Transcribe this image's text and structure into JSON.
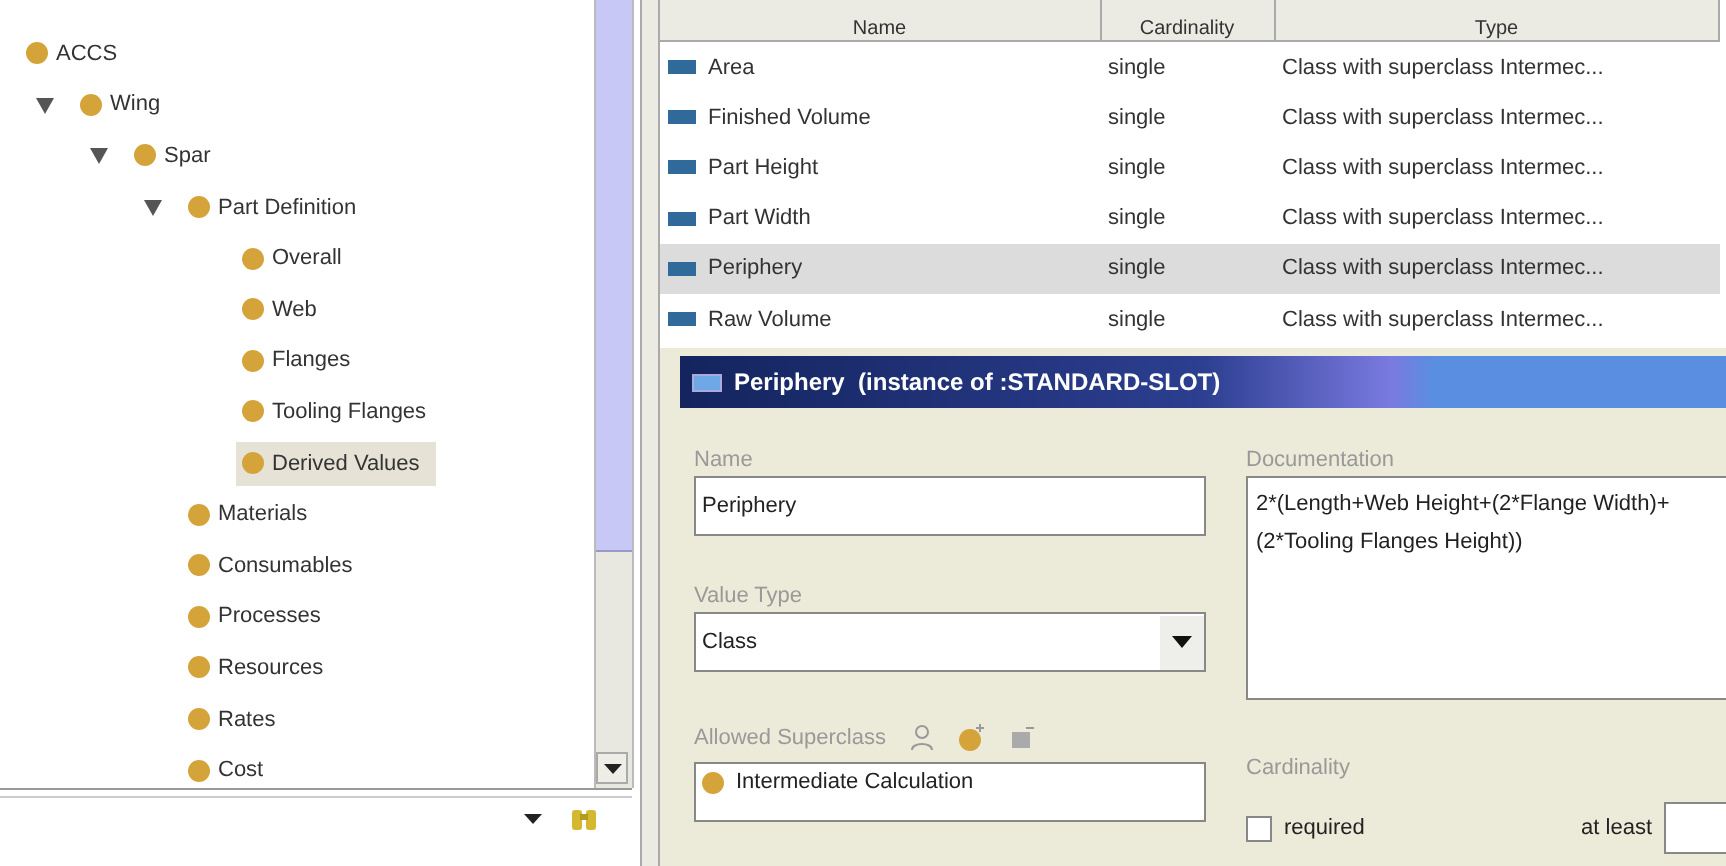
{
  "tree": {
    "items": [
      {
        "label": "ACCS",
        "children": [
          {
            "label": "Wing",
            "expanded": true,
            "children": [
              {
                "label": "Spar",
                "expanded": true,
                "children": [
                  {
                    "label": "Part Definition",
                    "expanded": true,
                    "children": [
                      {
                        "label": "Overall",
                        "selected": false
                      },
                      {
                        "label": "Web",
                        "selected": false
                      },
                      {
                        "label": "Flanges",
                        "selected": false
                      },
                      {
                        "label": "Tooling Flanges",
                        "selected": false
                      },
                      {
                        "label": "Derived Values",
                        "selected": true
                      }
                    ]
                  },
                  {
                    "label": "Materials",
                    "selected": false
                  },
                  {
                    "label": "Consumables",
                    "selected": false
                  },
                  {
                    "label": "Processes",
                    "selected": false
                  },
                  {
                    "label": "Resources",
                    "selected": false
                  },
                  {
                    "label": "Rates",
                    "selected": false
                  },
                  {
                    "label": "Cost",
                    "selected": false
                  }
                ]
              }
            ]
          }
        ]
      }
    ]
  },
  "slots_table": {
    "columns": [
      "Name",
      "Cardinality",
      "Type"
    ],
    "rows": [
      {
        "name": "Area",
        "cardinality": "single",
        "type": "Class with superclass Intermec...",
        "selected": false
      },
      {
        "name": "Finished Volume",
        "cardinality": "single",
        "type": "Class with superclass Intermec...",
        "selected": false
      },
      {
        "name": "Part Height",
        "cardinality": "single",
        "type": "Class with superclass Intermec...",
        "selected": false
      },
      {
        "name": "Part Width",
        "cardinality": "single",
        "type": "Class with superclass Intermec...",
        "selected": false
      },
      {
        "name": "Periphery",
        "cardinality": "single",
        "type": "Class with superclass Intermec...",
        "selected": true
      },
      {
        "name": "Raw Volume",
        "cardinality": "single",
        "type": "Class with superclass Intermec...",
        "selected": false
      }
    ]
  },
  "slot_form": {
    "title": "Periphery",
    "subtitle": "(instance of :STANDARD-SLOT)",
    "name": {
      "label": "Name",
      "value": "Periphery"
    },
    "documentation": {
      "label": "Documentation",
      "value": "2*(Length+Web Height+(2*Flange Width)+(2*Tooling Flanges Height))"
    },
    "value_type": {
      "label": "Value Type",
      "value": "Class"
    },
    "allowed_superclass": {
      "label": "Allowed Superclass",
      "items": [
        "Intermediate Calculation"
      ]
    },
    "cardinality": {
      "label": "Cardinality",
      "required": {
        "label": "required",
        "checked": false
      },
      "at_least": {
        "label": "at least"
      }
    }
  }
}
